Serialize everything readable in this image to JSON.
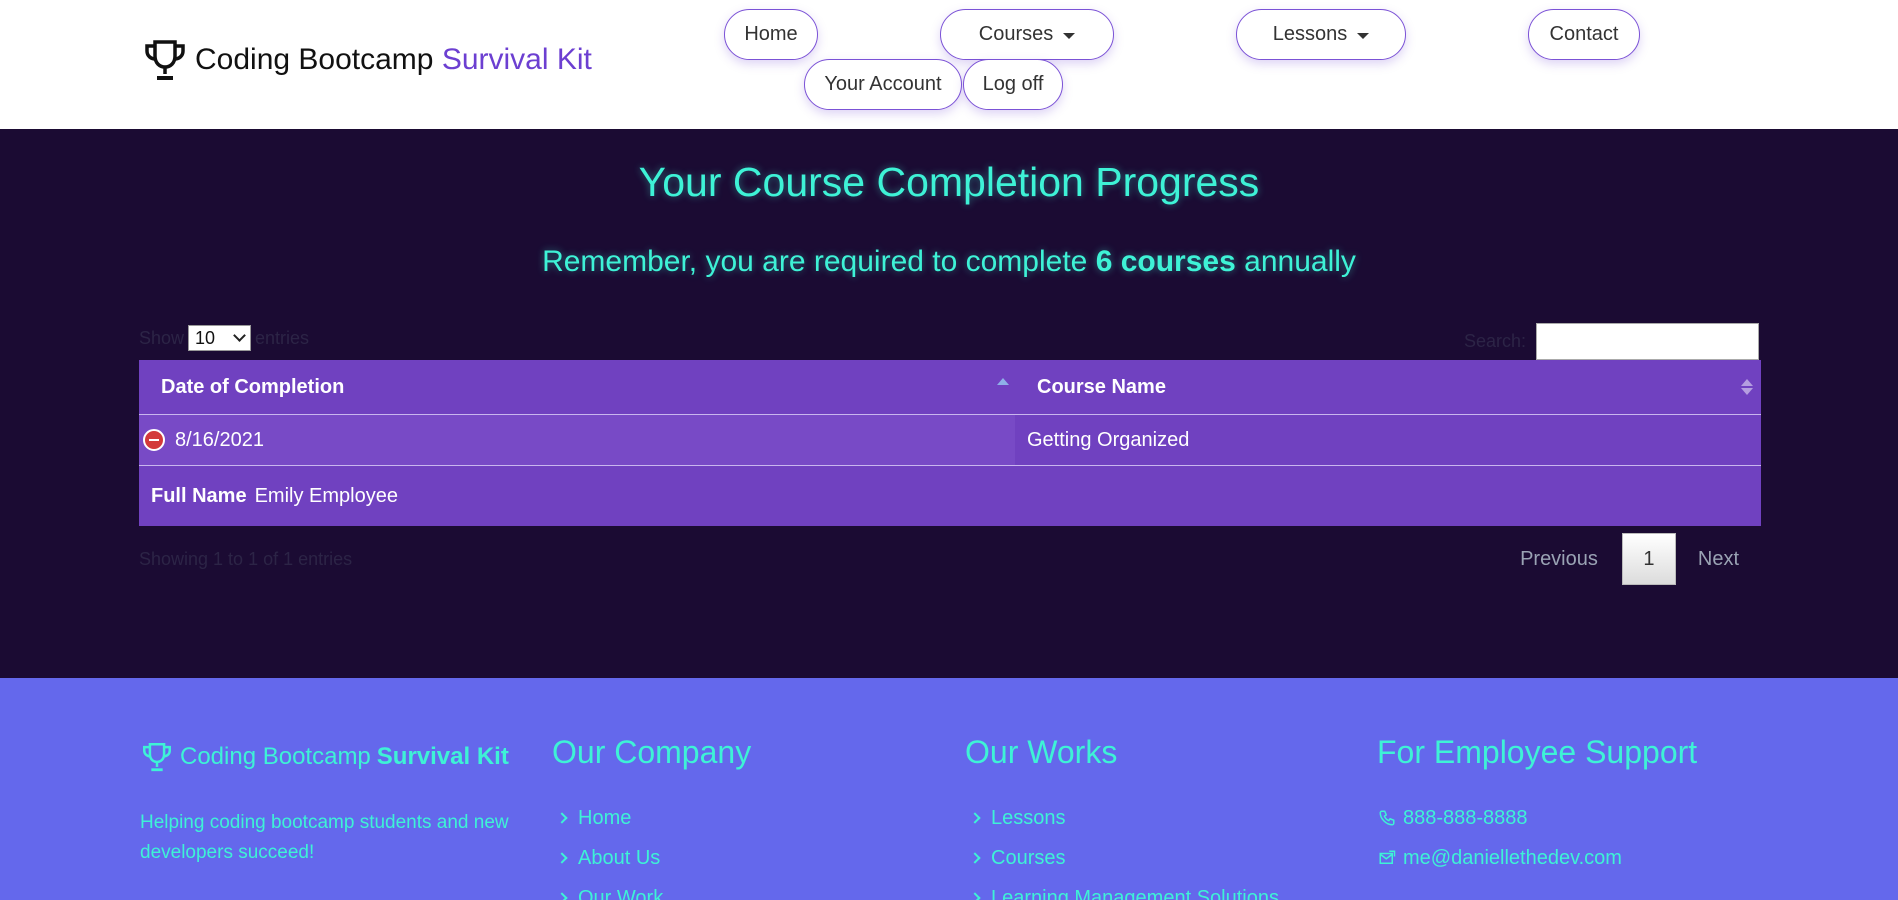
{
  "header": {
    "brand_main": "Coding Bootcamp",
    "brand_accent": "Survival Kit",
    "nav": {
      "home": "Home",
      "courses": "Courses",
      "lessons": "Lessons",
      "contact": "Contact",
      "account": "Your Account",
      "logoff": "Log off"
    }
  },
  "main": {
    "title": "Your Course Completion Progress",
    "subtitle_before": "Remember, you are required to complete",
    "subtitle_bold": "6 courses",
    "subtitle_after": "annually",
    "length_label_before": "Show",
    "length_value": "10",
    "length_label_after": "entries",
    "search_label": "Search:",
    "search_value": "",
    "table": {
      "columns": [
        "Date of Completion",
        "Course Name"
      ],
      "rows": [
        {
          "date": "8/16/2021",
          "course": "Getting Organized"
        }
      ],
      "child": {
        "label": "Full Name",
        "value": "Emily Employee"
      }
    },
    "info": "Showing 1 to 1 of 1 entries",
    "pager": {
      "previous": "Previous",
      "current": "1",
      "next": "Next"
    }
  },
  "footer": {
    "brand_main": "Coding Bootcamp",
    "brand_accent": "Survival Kit",
    "tagline": "Helping coding bootcamp students and new developers succeed!",
    "company": {
      "heading": "Our Company",
      "links": [
        "Home",
        "About Us",
        "Our Work"
      ]
    },
    "works": {
      "heading": "Our Works",
      "links": [
        "Lessons",
        "Courses",
        "Learning Management Solutions"
      ]
    },
    "support": {
      "heading": "For Employee Support",
      "phone": "888-888-8888",
      "email": "me@daniellethedev.com"
    }
  },
  "colors": {
    "accent_purple": "#6c3fd1",
    "dark_bg": "#1b0b33",
    "table_bg": "#7041c0",
    "teal_text": "#3ef2d6",
    "footer_bg": "#6468ec"
  },
  "icons": {
    "brand": "trophy-icon",
    "remove_row": "minus-circle-icon",
    "phone": "phone-icon",
    "email": "envelope-icon",
    "link_bullet": "chevron-right-icon"
  }
}
